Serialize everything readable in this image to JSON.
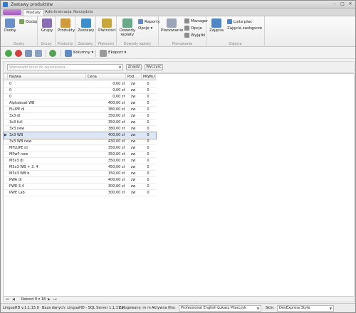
{
  "window": {
    "title": "Zestawy produktów",
    "controls": [
      "–",
      "□",
      "✕"
    ]
  },
  "ribbon_tabs": [
    {
      "label": "Moduły",
      "active": true
    },
    {
      "label": "Administracja",
      "active": false
    },
    {
      "label": "Narzędzia",
      "active": false
    }
  ],
  "ribbon": {
    "osoby": {
      "btn": "Osoby",
      "dodaj": "Dodaj",
      "caption": "Osoby"
    },
    "grupy": {
      "btn": "Grupy",
      "caption": "Grupy"
    },
    "produkty": {
      "btn": "Produkty",
      "caption": "Produkty"
    },
    "zestawy": {
      "btn": "Zestawy",
      "caption": "Zestawy"
    },
    "platnosci": {
      "btn": "Płatności",
      "caption": "Płatności"
    },
    "dowody": {
      "btn1": "Dowody",
      "btn2": "wpłaty",
      "raporty": "Raporty",
      "opcje": "Opcje ▾",
      "caption": "Dowody wpłaty"
    },
    "planowanie": {
      "btn": "Planowanie",
      "manager": "Manager",
      "opcje": "Opcje",
      "wyjatki": "Wyjątki",
      "caption": "Planowanie"
    },
    "zajecia": {
      "btn": "Zajęcia",
      "lista": "Lista płac",
      "zastepcze": "Zajęcia zastępcze",
      "caption": "Zajęcia"
    }
  },
  "toolbar": {
    "kolumny": "Kolumny ▾",
    "eksport": "Eksport ▾"
  },
  "search": {
    "placeholder": "Wprowadź tekst do wyszukania...",
    "znajdz": "Znajdź",
    "wyczysc": "Wyczyść"
  },
  "grid": {
    "columns": [
      "Nazwa",
      "Cena",
      "Pod.",
      "PKWiU"
    ],
    "rows": [
      [
        "0",
        "0,00 zł",
        "zw",
        "0"
      ],
      [
        "0",
        "0,00 zł",
        "zw",
        "0"
      ],
      [
        "0",
        "0,00 zł",
        "zw",
        "0"
      ],
      [
        "Alphaboat WB",
        "400,00 zł",
        "zw",
        "0"
      ],
      [
        "FLUPE dl",
        "380,00 zł",
        "zw",
        "0"
      ],
      [
        "3x3 dl",
        "350,00 zł",
        "zw",
        "0"
      ],
      [
        "3x3 full",
        "350,00 zł",
        "zw",
        "0"
      ],
      [
        "3x3 new",
        "380,00 zł",
        "zw",
        "0"
      ],
      [
        "3x3 WB",
        "400,00 zł",
        "zw",
        "0"
      ],
      [
        "3x3 WB new",
        "430,00 zł",
        "zw",
        "0"
      ],
      [
        "MFLUPE dl",
        "350,00 zł",
        "zw",
        "0"
      ],
      [
        "MPwP new",
        "350,00 zł",
        "zw",
        "0"
      ],
      [
        "M3x3 dl",
        "350,00 zł",
        "zw",
        "0"
      ],
      [
        "M3x3 WB + 3, 4",
        "450,00 zł",
        "zw",
        "0"
      ],
      [
        "M3x3 WB b",
        "150,00 zł",
        "zw",
        "0"
      ],
      [
        "PWA dl",
        "400,00 zł",
        "zw",
        "0"
      ],
      [
        "PWE 3,4",
        "300,00 zł",
        "zw",
        "0"
      ],
      [
        "PWE Lab",
        "300,00 zł",
        "zw",
        "0"
      ]
    ],
    "selected_index": 8
  },
  "navigator": {
    "record": "Rekord 9 z 18",
    "first": "⏮",
    "prev": "◀",
    "next": "▶",
    "last": "⏭"
  },
  "status": {
    "version": "LinguaHD v.1.1.15.0",
    "db": "Baza danych: LinguaHD - SQL Server 1.1.17.0",
    "user": "Zalogowany: m m",
    "filia_label": "Aktywna filia:",
    "filia_value": "Professional English Łukasz Pilarczyk",
    "skin_label": "Skin:",
    "skin_value": "DevExpress Style"
  },
  "colors": {
    "accent": "#2e7bd4",
    "selection": "#dde6f5",
    "ribbon_menu": "#a05bbd"
  }
}
